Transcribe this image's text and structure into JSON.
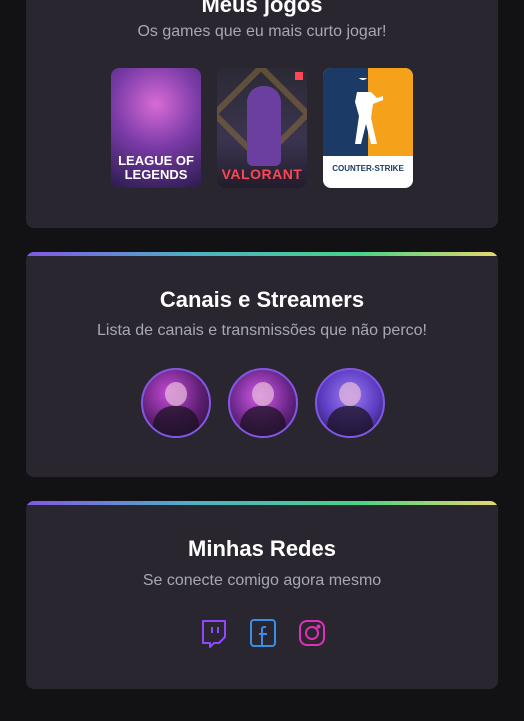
{
  "games_section": {
    "title": "Meus jogos",
    "subtitle": "Os games que eu mais curto jogar!",
    "games": [
      {
        "name": "League of Legends",
        "label_line1": "LEAGUE OF",
        "label_line2": "LEGENDS"
      },
      {
        "name": "Valorant",
        "label": "VALORANT"
      },
      {
        "name": "Counter-Strike",
        "label": "COUNTER-STRIKE"
      }
    ]
  },
  "streamers_section": {
    "title": "Canais e Streamers",
    "subtitle": "Lista de canais e transmissões que não perco!"
  },
  "social_section": {
    "title": "Minhas Redes",
    "subtitle": "Se conecte comigo agora mesmo",
    "icons": [
      "twitch-icon",
      "facebook-icon",
      "instagram-icon"
    ]
  },
  "colors": {
    "background": "#121214",
    "card": "#29262f",
    "accent": "#8257e5",
    "twitch": "#9147ff",
    "facebook": "#3b8ee8",
    "instagram": "#e02fb9"
  }
}
